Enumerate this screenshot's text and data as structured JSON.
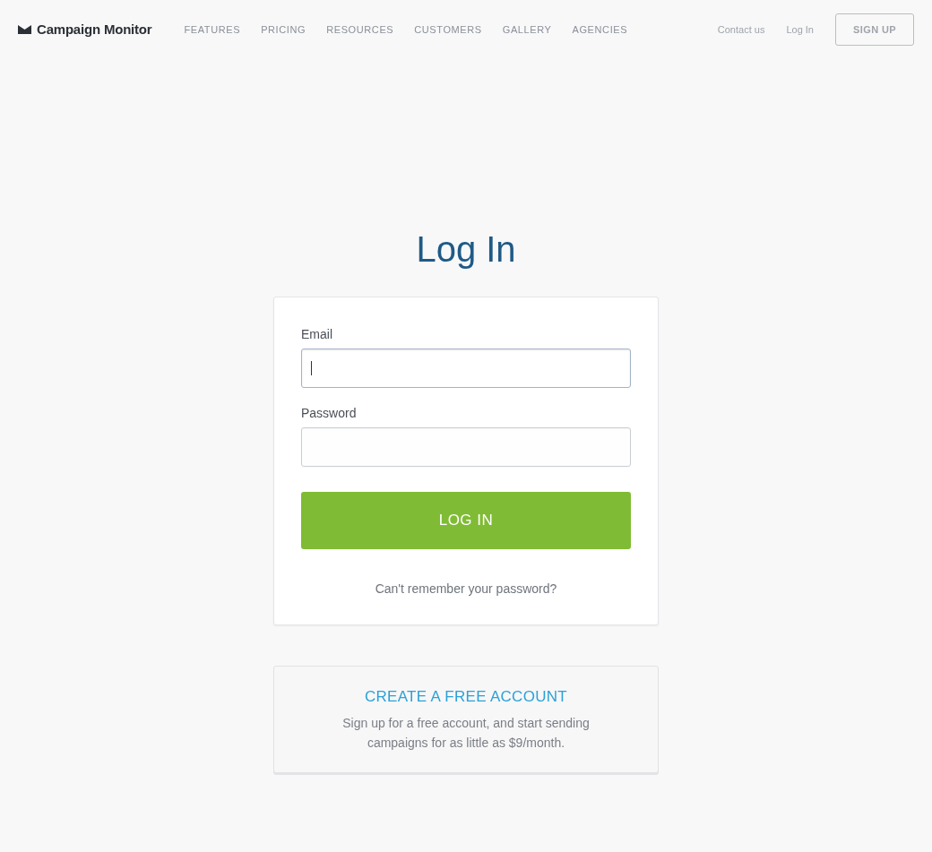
{
  "header": {
    "logo": "Campaign Monitor",
    "nav": [
      "FEATURES",
      "PRICING",
      "RESOURCES",
      "CUSTOMERS",
      "GALLERY",
      "AGENCIES"
    ],
    "links": [
      "Contact us",
      "Log In"
    ],
    "signup_button": "SIGN UP"
  },
  "title": "Log In",
  "form": {
    "fields": [
      {
        "label": "Email",
        "focused": true
      },
      {
        "label": "Password",
        "focused": false
      }
    ],
    "submit_button": "LOG IN",
    "forgot_link": "Can't remember your password?"
  },
  "signup_card": {
    "title": "CREATE A FREE ACCOUNT",
    "text": "Sign up for a free account, and start sending campaigns for as little as $9/month."
  }
}
